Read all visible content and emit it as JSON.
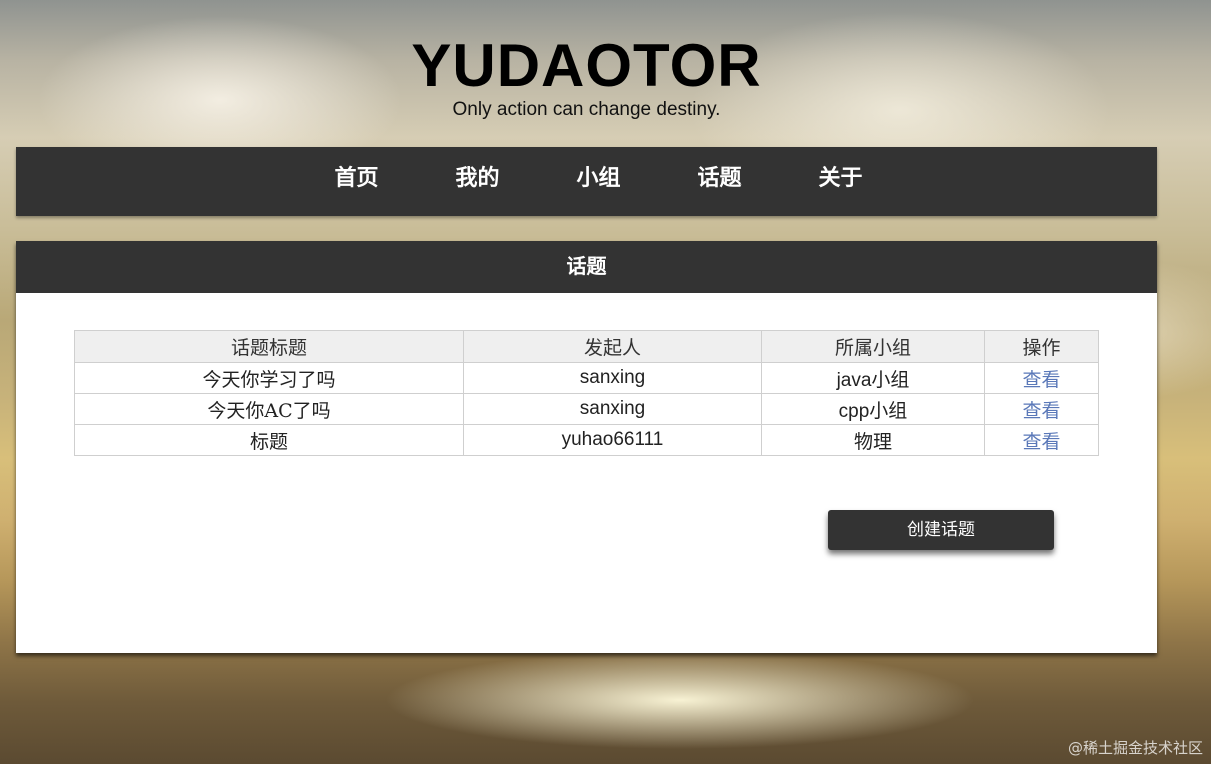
{
  "site": {
    "title": "YUDAOTOR",
    "subtitle": "Only action can change destiny."
  },
  "nav": {
    "items": [
      {
        "label": "首页"
      },
      {
        "label": "我的"
      },
      {
        "label": "小组"
      },
      {
        "label": "话题"
      },
      {
        "label": "关于"
      }
    ]
  },
  "panel": {
    "title": "话题",
    "table": {
      "headers": [
        "话题标题",
        "发起人",
        "所属小组",
        "操作"
      ],
      "rows": [
        {
          "title": "今天你学习了吗",
          "author": "sanxing",
          "group": "java小组",
          "action": "查看"
        },
        {
          "title": "今天你AC了吗",
          "author": "sanxing",
          "group": "cpp小组",
          "action": "查看"
        },
        {
          "title": "标题",
          "author": "yuhao66111",
          "group": "物理",
          "action": "查看"
        }
      ]
    },
    "create_button": "创建话题"
  },
  "watermark": "@稀土掘金技术社区",
  "colors": {
    "bar": "#333333",
    "link": "#5a78b8",
    "header_cell": "#efefef"
  }
}
